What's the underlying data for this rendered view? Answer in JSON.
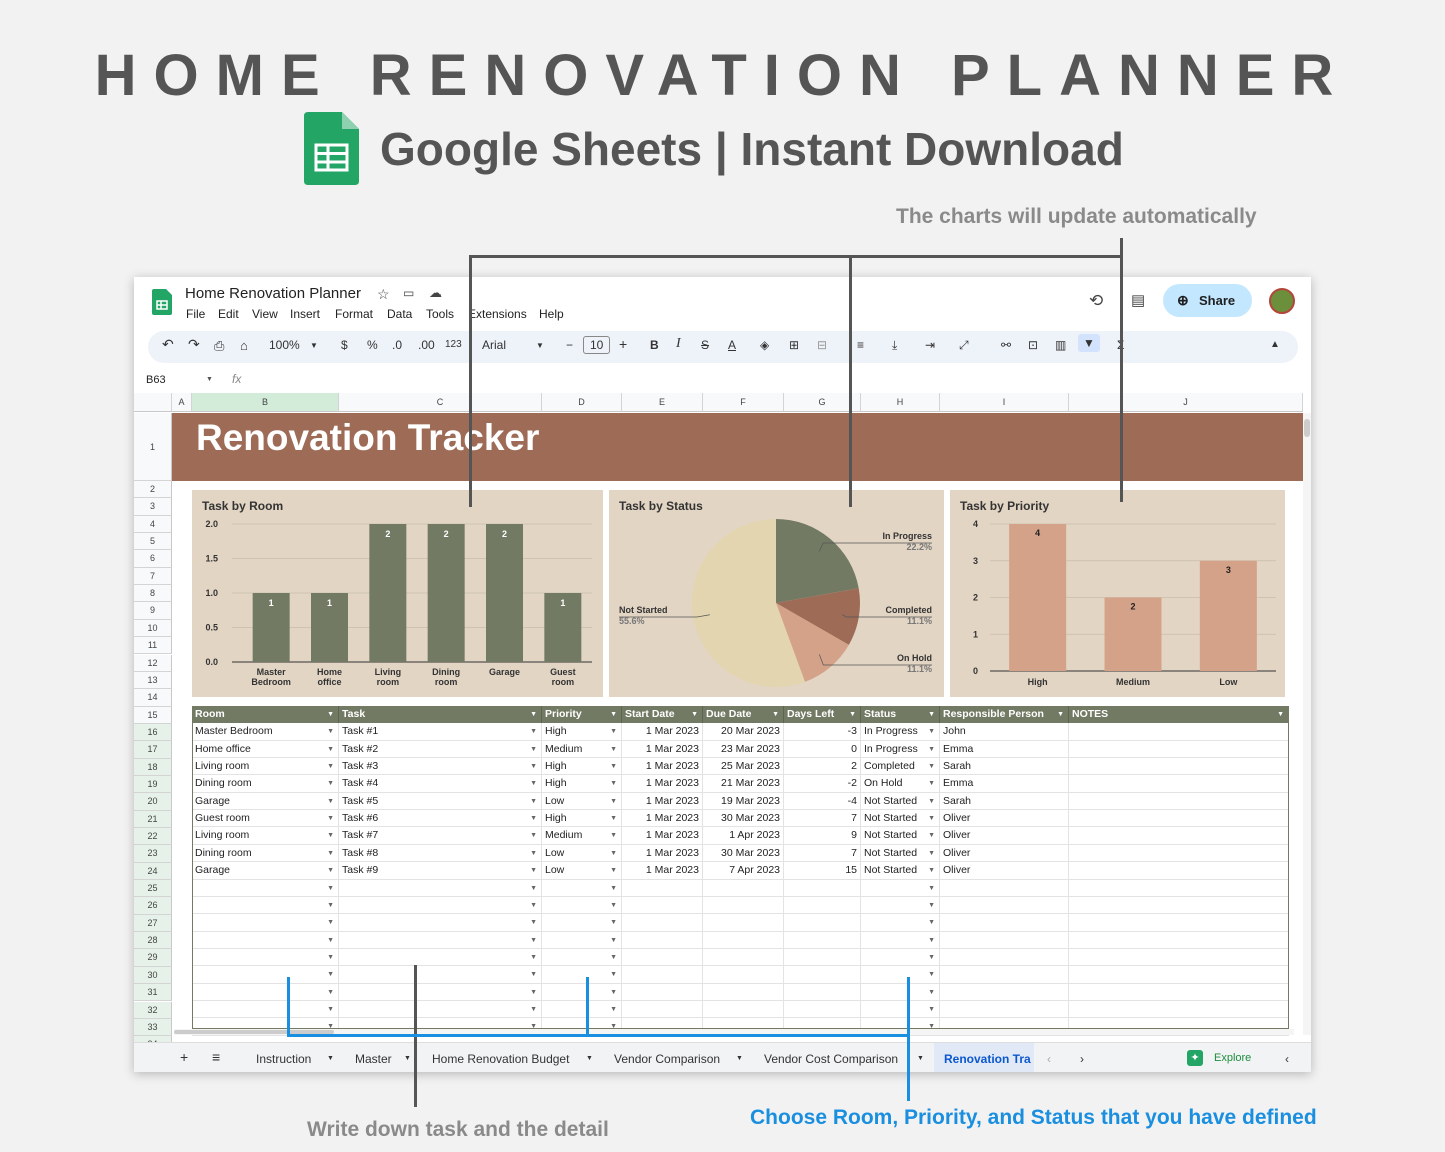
{
  "header": {
    "title": "HOME RENOVATION PLANNER",
    "subtitle": "Google Sheets | Instant Download"
  },
  "annotations": {
    "top": "The charts will update automatically",
    "bottom_left": "Write down task and the detail",
    "bottom_right": "Choose Room, Priority, and Status that you have defined"
  },
  "app": {
    "doc_title": "Home Renovation Planner",
    "menu": [
      "File",
      "Edit",
      "View",
      "Insert",
      "Format",
      "Data",
      "Tools",
      "Extensions",
      "Help"
    ],
    "share": "Share",
    "name_box": "B63",
    "fx": "fx",
    "zoom": "100%",
    "font": "Arial",
    "font_size": "10",
    "currency": "$",
    "percent": "%",
    "dec_less": ".0",
    "dec_more": ".00",
    "num_fmt": "123"
  },
  "columns": [
    "A",
    "B",
    "C",
    "D",
    "E",
    "F",
    "G",
    "H",
    "I",
    "J"
  ],
  "rows": [
    "1",
    "2",
    "3",
    "4",
    "5",
    "6",
    "7",
    "8",
    "9",
    "10",
    "11",
    "12",
    "13",
    "14",
    "15",
    "16",
    "17",
    "18",
    "19",
    "20",
    "21",
    "22",
    "23",
    "24",
    "25",
    "26",
    "27",
    "28",
    "29",
    "30",
    "31",
    "32",
    "33",
    "34"
  ],
  "banner": "Renovation Tracker",
  "chart_data": [
    {
      "type": "bar",
      "title": "Task by Room",
      "categories": [
        "Master Bedroom",
        "Home office",
        "Living room",
        "Dining room",
        "Garage",
        "Guest room"
      ],
      "values": [
        1,
        1,
        2,
        2,
        2,
        1
      ],
      "ylim": [
        0,
        2
      ],
      "yticks": [
        "0.0",
        "0.5",
        "1.0",
        "1.5",
        "2.0"
      ],
      "color": "#737a64"
    },
    {
      "type": "pie",
      "title": "Task by Status",
      "labels": [
        "In Progress",
        "Completed",
        "On Hold",
        "Not Started"
      ],
      "values": [
        22.2,
        11.1,
        11.1,
        55.6
      ],
      "pct_labels": [
        "22.2%",
        "11.1%",
        "11.1%",
        "55.6%"
      ],
      "colors": [
        "#737a64",
        "#9e6b56",
        "#d4a288",
        "#e2d5b0"
      ]
    },
    {
      "type": "bar",
      "title": "Task by Priority",
      "categories": [
        "High",
        "Medium",
        "Low"
      ],
      "values": [
        4,
        2,
        3
      ],
      "ylim": [
        0,
        4
      ],
      "yticks": [
        "0",
        "1",
        "2",
        "3",
        "4"
      ],
      "color": "#d4a288"
    }
  ],
  "table": {
    "headers": [
      "Room",
      "Task",
      "Priority",
      "Start Date",
      "Due Date",
      "Days Left",
      "Status",
      "Responsible Person",
      "NOTES"
    ],
    "rows": [
      [
        "Master Bedroom",
        "Task #1",
        "High",
        "1 Mar 2023",
        "20 Mar 2023",
        "-3",
        "In Progress",
        "John",
        ""
      ],
      [
        "Home office",
        "Task #2",
        "Medium",
        "1 Mar 2023",
        "23 Mar 2023",
        "0",
        "In Progress",
        "Emma",
        ""
      ],
      [
        "Living room",
        "Task #3",
        "High",
        "1 Mar 2023",
        "25 Mar 2023",
        "2",
        "Completed",
        "Sarah",
        ""
      ],
      [
        "Dining room",
        "Task #4",
        "High",
        "1 Mar 2023",
        "21 Mar 2023",
        "-2",
        "On Hold",
        "Emma",
        ""
      ],
      [
        "Garage",
        "Task #5",
        "Low",
        "1 Mar 2023",
        "19 Mar 2023",
        "-4",
        "Not Started",
        "Sarah",
        ""
      ],
      [
        "Guest room",
        "Task #6",
        "High",
        "1 Mar 2023",
        "30 Mar 2023",
        "7",
        "Not Started",
        "Oliver",
        ""
      ],
      [
        "Living room",
        "Task #7",
        "Medium",
        "1 Mar 2023",
        "1 Apr 2023",
        "9",
        "Not Started",
        "Oliver",
        ""
      ],
      [
        "Dining room",
        "Task #8",
        "Low",
        "1 Mar 2023",
        "30 Mar 2023",
        "7",
        "Not Started",
        "Oliver",
        ""
      ],
      [
        "Garage",
        "Task #9",
        "Low",
        "1 Mar 2023",
        "7 Apr 2023",
        "15",
        "Not Started",
        "Oliver",
        ""
      ]
    ],
    "empty_rows": 9
  },
  "tabs": [
    "Instruction",
    "Master",
    "Home Renovation Budget",
    "Vendor Comparison",
    "Vendor Cost Comparison",
    "Renovation Tra"
  ],
  "explore": "Explore",
  "colors": {
    "banner": "#9e6b56",
    "header": "#737a64",
    "panel": "#e2d5c4",
    "accent": "#1a8fe0"
  }
}
